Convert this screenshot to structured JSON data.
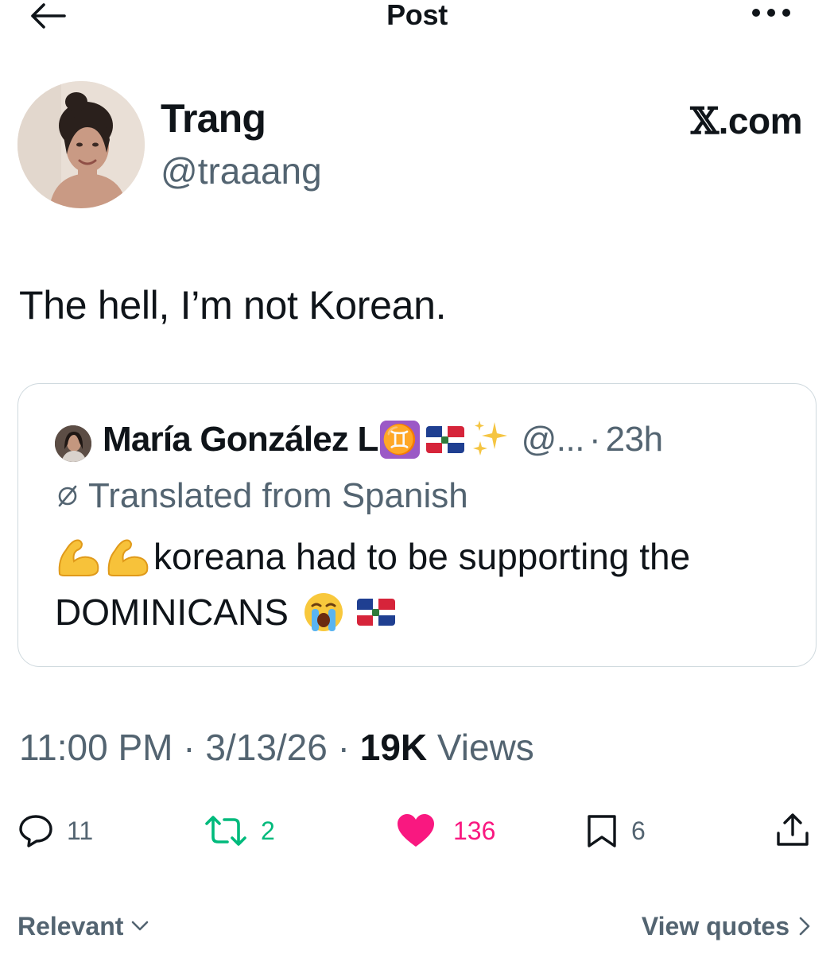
{
  "header": {
    "title": "Post",
    "back_icon": "arrow-left-icon",
    "more_icon": "more-horizontal-icon"
  },
  "author": {
    "name": "Trang",
    "handle": "@traaang",
    "avatar_icon": "profile-photo"
  },
  "watermark": {
    "x_glyph": "𝕏",
    "text": ".com"
  },
  "tweet": {
    "text": "The hell, I’m not Korean."
  },
  "quote": {
    "name": "María González L",
    "badges": [
      "gemini-sign-emoji",
      "dominican-flag-emoji",
      "sparkles-emoji"
    ],
    "gemini_glyph": "♊",
    "handle": "@...",
    "separator": "·",
    "time": "23h",
    "translated_label": "Translated from Spanish",
    "text_line1": "koreana had to be supporting the",
    "text_line2": "DOMINICANS",
    "line1_emojis": [
      "flexed-biceps-emoji",
      "flexed-biceps-emoji"
    ],
    "line2_emojis": [
      "loudly-crying-face-emoji",
      "dominican-flag-emoji"
    ]
  },
  "meta": {
    "time": "11:00 PM",
    "separator": "·",
    "date": "3/13/26",
    "views_count": "19K",
    "views_label": "Views"
  },
  "actions": {
    "replies": "11",
    "reposts": "2",
    "likes": "136",
    "bookmarks": "6"
  },
  "footer": {
    "sort_label": "Relevant",
    "view_quotes_label": "View quotes"
  },
  "colors": {
    "text": "#0f1419",
    "secondary": "#536471",
    "repost": "#00ba7c",
    "like": "#f91880",
    "border": "#cfd9de"
  }
}
